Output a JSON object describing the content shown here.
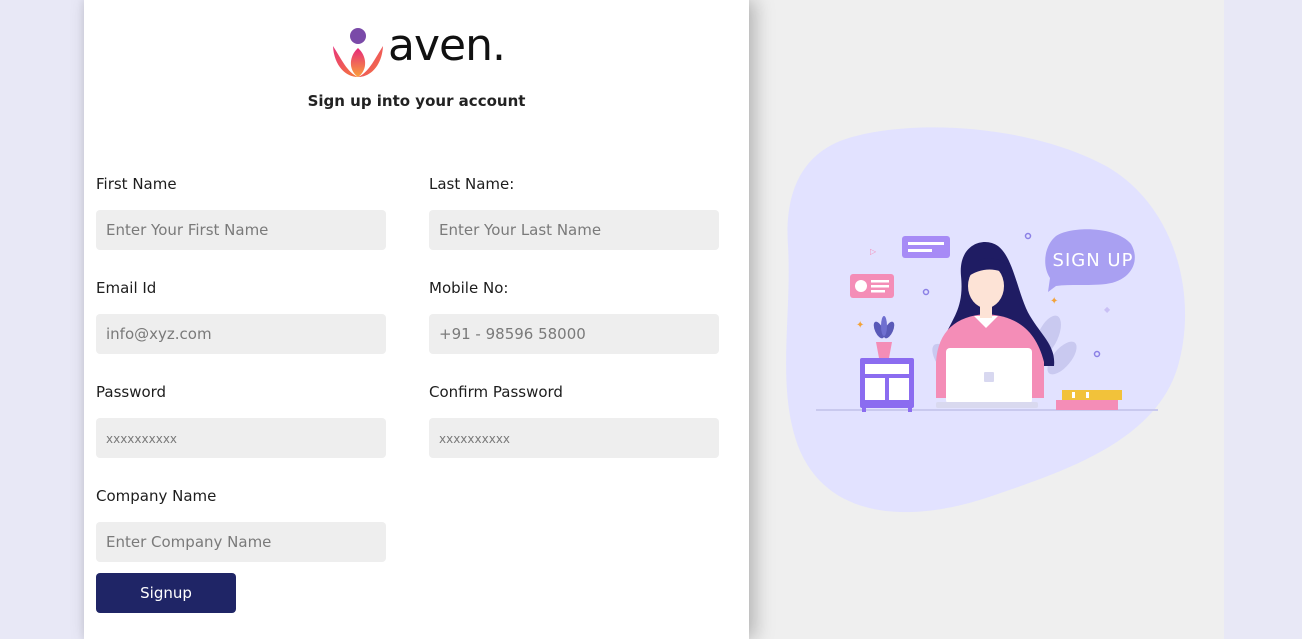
{
  "brand": {
    "name": "aven."
  },
  "form": {
    "subtitle": "Sign up into your account",
    "fields": [
      {
        "label": "First Name",
        "placeholder": "Enter Your First Name"
      },
      {
        "label": "Last Name:",
        "placeholder": "Enter Your Last Name"
      },
      {
        "label": "Email Id",
        "placeholder": "info@xyz.com"
      },
      {
        "label": "Mobile No:",
        "placeholder": "+91 - 98596 58000"
      },
      {
        "label": "Password",
        "placeholder": "xxxxxxxxxx"
      },
      {
        "label": "Confirm Password",
        "placeholder": "xxxxxxxxxx"
      },
      {
        "label": "Company Name",
        "placeholder": "Enter Company Name"
      }
    ],
    "submit_label": "Signup"
  },
  "illustration": {
    "sign_text": "SIGN UP"
  },
  "colors": {
    "accent": "#1f2566",
    "blob": "#e2e2ff",
    "logo_purple": "#7a4aa8",
    "logo_orange": "#f26b3a",
    "logo_pink": "#e6287a"
  }
}
